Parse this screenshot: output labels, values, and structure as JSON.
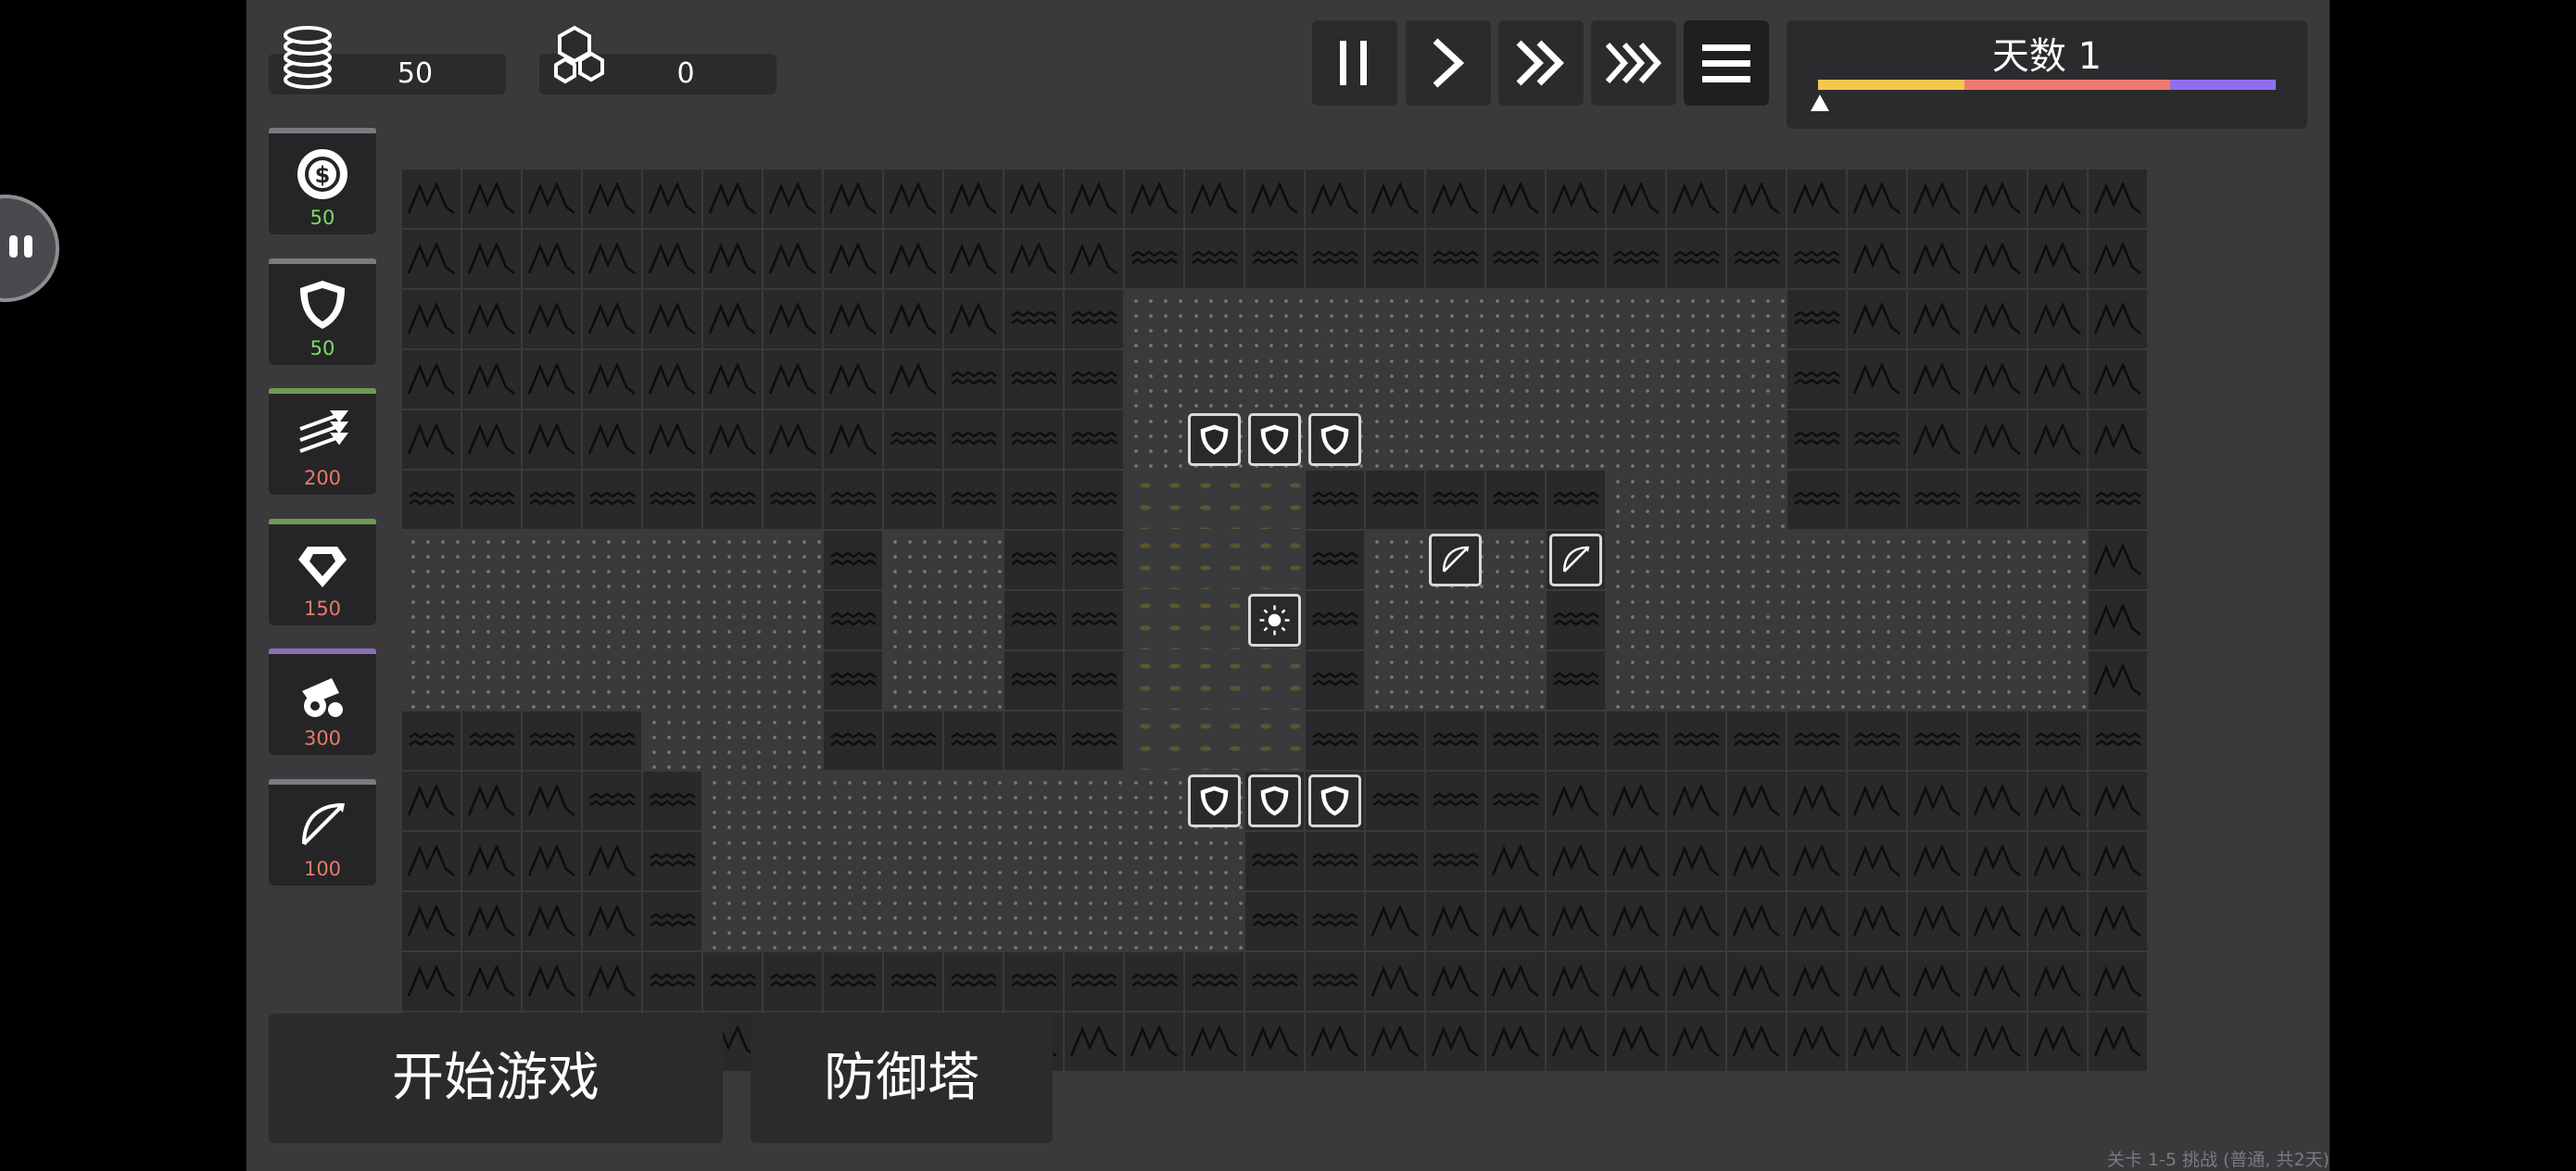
{
  "resources": {
    "coins": "50",
    "gems": "0"
  },
  "shop": [
    {
      "name": "coin-tower",
      "icon": "dollar-coin-icon",
      "price": "50",
      "bar_color": "#7b7b7f",
      "price_color": "#7ddc6a"
    },
    {
      "name": "shield-tower",
      "icon": "shield-icon",
      "price": "50",
      "bar_color": "#7b7b7f",
      "price_color": "#7ddc6a"
    },
    {
      "name": "arrow-tower",
      "icon": "arrows-icon",
      "price": "200",
      "bar_color": "#6d9b52",
      "price_color": "#e77a6a"
    },
    {
      "name": "gem-tower",
      "icon": "diamond-icon",
      "price": "150",
      "bar_color": "#6d9b52",
      "price_color": "#e77a6a"
    },
    {
      "name": "cannon-tower",
      "icon": "cannon-icon",
      "price": "300",
      "bar_color": "#8a6fb4",
      "price_color": "#e77a6a"
    },
    {
      "name": "bow-tower",
      "icon": "bow-icon",
      "price": "100",
      "bar_color": "#7b7b7f",
      "price_color": "#e77a6a"
    }
  ],
  "controls": [
    "pause-icon",
    "play-icon",
    "fast-forward-icon",
    "fastest-forward-icon",
    "menu-icon"
  ],
  "day": {
    "label": "天数 1",
    "progress": 0.0,
    "segments": [
      "#f2c94c",
      "#f07b6f",
      "#8f6ef0"
    ]
  },
  "map": [
    "mmmmmmmmmmmmmmmmmmmmmmmmmmmmm",
    "mmmmmmmmmmmmwwwwwwwwwwwwmmmmm",
    "mmmmmmmmmmwwgggggggggggwmmmmm",
    "mmmmmmmmmwwwgggggggggggwmmmmm",
    "mmmmmmmmwwwwgggggggggggwwmmmm",
    "wwwwwwwwwwwwssswwwwwgggwwwwww",
    "gggggggwggwwssswgggwgggggggg",
    "gggggggwggwwssswgggwgggggggg",
    "gggggggwggwwssswgggwgggggggg",
    "wwwwgggwwwwwssswwwwwwwwwwwwww",
    "mmmwwgggggggggwwwwwmmmmmmmmm",
    "mmmmwgggggggggwwwwmmmmmmmmmm",
    "mmmmwgggggggggwwmmmmmmmmmmmm",
    "mmmmwwwwwwwwwwwwmmmmmmmmmmmm",
    "mmmmmmmmmmmmmmmmmmmmmmmmmmmm"
  ],
  "units": [
    {
      "row": 4,
      "col": 13,
      "icon": "shield-icon"
    },
    {
      "row": 4,
      "col": 14,
      "icon": "shield-icon"
    },
    {
      "row": 4,
      "col": 15,
      "icon": "shield-icon"
    },
    {
      "row": 6,
      "col": 17,
      "icon": "bow-icon"
    },
    {
      "row": 6,
      "col": 19,
      "icon": "bow-icon"
    },
    {
      "row": 7,
      "col": 14,
      "icon": "sun-icon"
    },
    {
      "row": 10,
      "col": 13,
      "icon": "shield-icon"
    },
    {
      "row": 10,
      "col": 14,
      "icon": "shield-icon"
    },
    {
      "row": 10,
      "col": 15,
      "icon": "shield-icon"
    }
  ],
  "buttons": {
    "start": "开始游戏",
    "towers": "防御塔"
  },
  "footer": "关卡 1-5 挑战 (普通, 共2天)"
}
